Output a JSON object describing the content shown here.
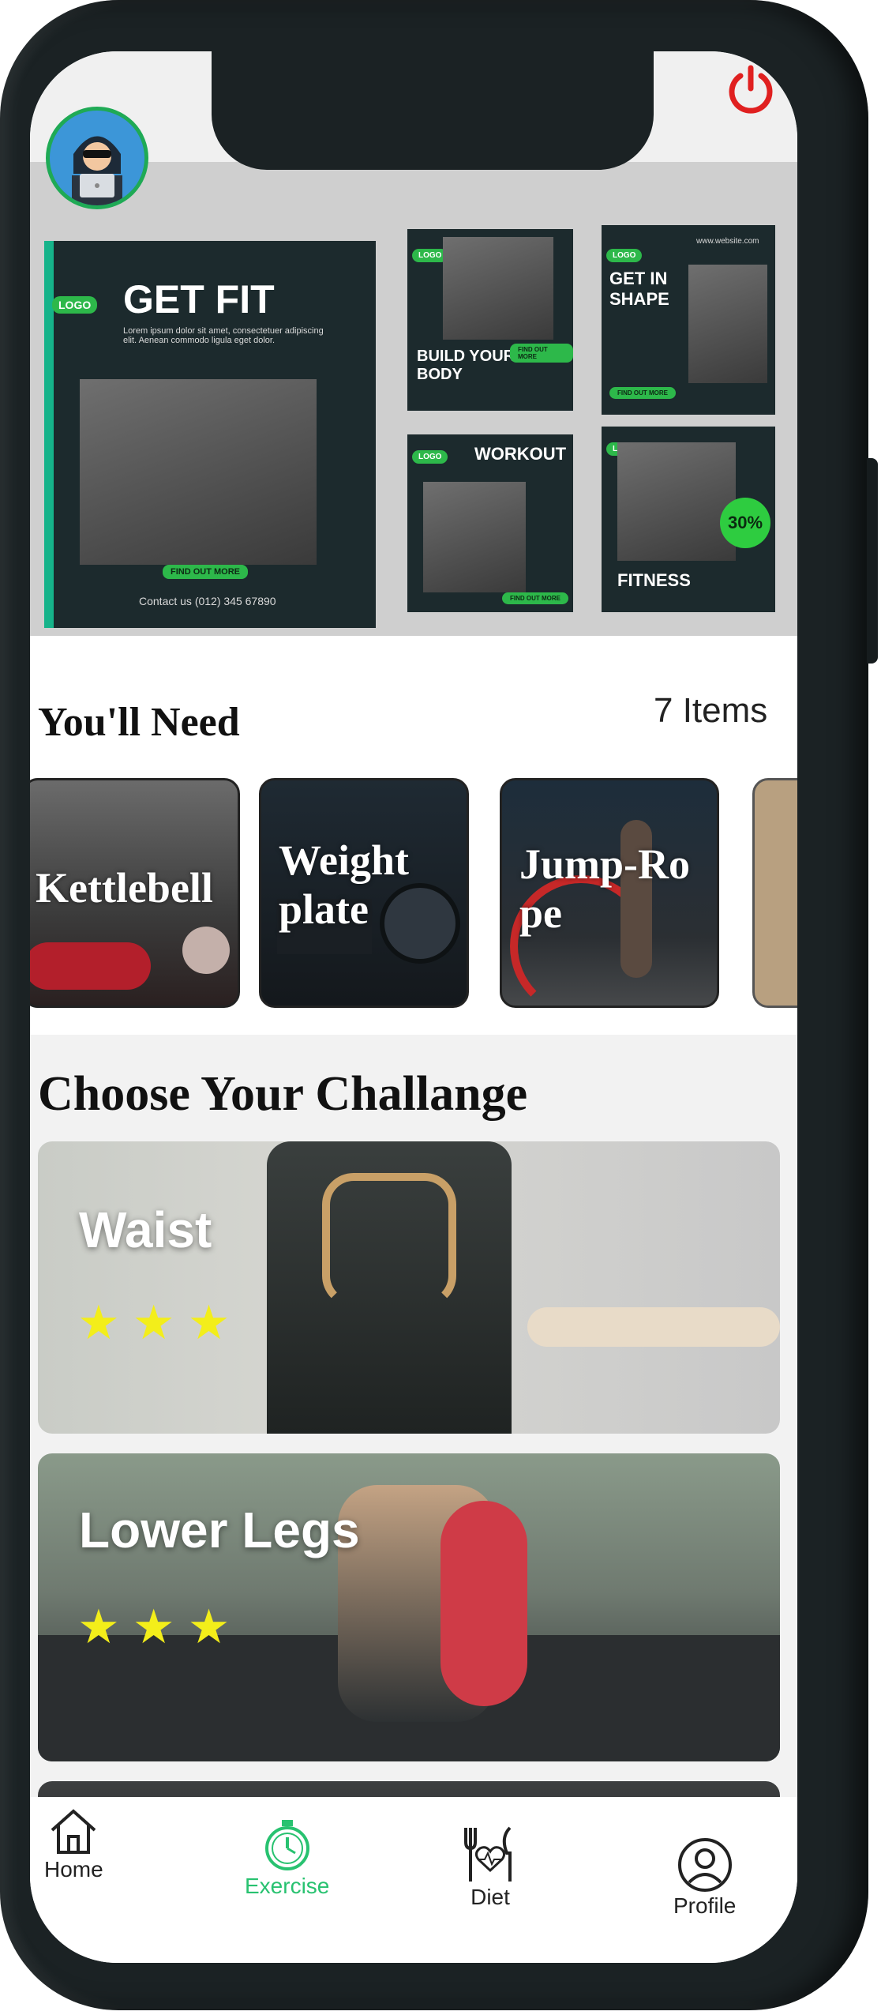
{
  "banner": {
    "main": {
      "logo": "LOGO",
      "title": "GET FIT",
      "body": "Lorem ipsum dolor sit amet, consectetuer adipiscing elit. Aenean commodo ligula eget dolor.",
      "cta": "FIND OUT MORE",
      "contact": "Contact us (012) 345 67890"
    },
    "cards": [
      {
        "logo": "LOGO",
        "title": "BUILD YOUR BODY",
        "cta": "FIND OUT MORE"
      },
      {
        "logo": "LOGO",
        "title": "GET IN SHAPE",
        "site": "www.website.com",
        "cta": "FIND OUT MORE"
      },
      {
        "logo": "LOGO",
        "title": "WORKOUT",
        "cta": "FIND OUT MORE"
      },
      {
        "logo": "LOGO",
        "title": "FITNESS",
        "badge": "30%"
      }
    ]
  },
  "equipment": {
    "title": "You'll Need",
    "count": "7 Items",
    "items": [
      {
        "label": "Kettlebell"
      },
      {
        "label": "Weight plate"
      },
      {
        "label": "Jump-Rope"
      }
    ]
  },
  "challenges": {
    "title": "Choose Your Challange",
    "items": [
      {
        "label": "Waist",
        "stars": "★★★",
        "rating": 3
      },
      {
        "label": "Lower Legs",
        "stars": "★★★",
        "rating": 3
      }
    ]
  },
  "nav": {
    "items": [
      {
        "label": "Home",
        "icon": "home-icon"
      },
      {
        "label": "Exercise",
        "icon": "stopwatch-icon",
        "active": true
      },
      {
        "label": "Diet",
        "icon": "diet-icon"
      },
      {
        "label": "Profile",
        "icon": "profile-icon"
      }
    ]
  },
  "colors": {
    "accent": "#28c270",
    "power": "#e02020",
    "star": "#f3ee1a"
  }
}
